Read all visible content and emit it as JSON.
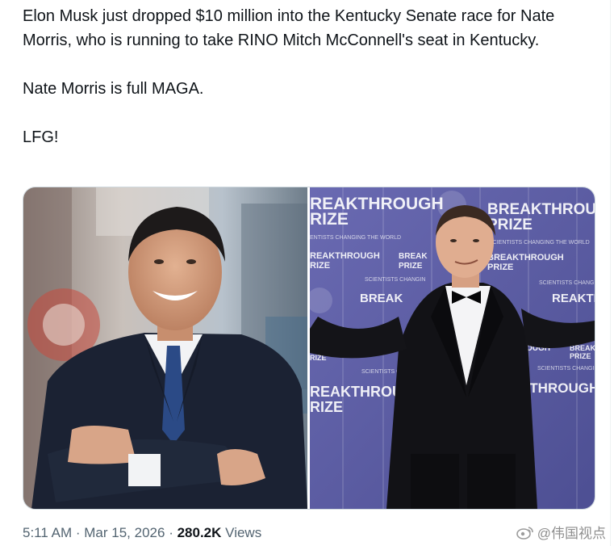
{
  "tweet": {
    "paragraphs": [
      "Elon Musk just dropped $10 million into the Kentucky Senate race for Nate Morris, who is running to take RINO Mitch McConnell's seat in Kentucky.",
      "Nate Morris is full MAGA.",
      "LFG!"
    ]
  },
  "media": {
    "right_photo_backdrop_text": {
      "brand_line1": "BREAKTHROUGH",
      "brand_line2": "PRIZE",
      "brand_line_partial": "REAKTHROUGH",
      "brand_line_partial2": "RIZE",
      "tagline": "SCIENTISTS CHANGING THE WORLD",
      "tagline_partial": "ENTISTS CHANGING THE WORLD",
      "tagline_short": "SCIENTISTS CHANGIN",
      "fragment_ough": "OUGH",
      "fragment_kthrough": "KTHROUGH",
      "fragment_break": "BREAK",
      "fragment_reakth": "REAKTH",
      "fragment_prize": "PRIZE"
    }
  },
  "meta": {
    "time": "5:11 AM",
    "separator": "·",
    "date": "Mar 15, 2026",
    "views_count": "280.2K",
    "views_label": "Views"
  },
  "watermark": {
    "text": "@伟国视点"
  },
  "colors": {
    "text": "#0f1419",
    "secondary": "#536471",
    "border": "#cfd9de",
    "backdrop": "#5a5aa0"
  }
}
